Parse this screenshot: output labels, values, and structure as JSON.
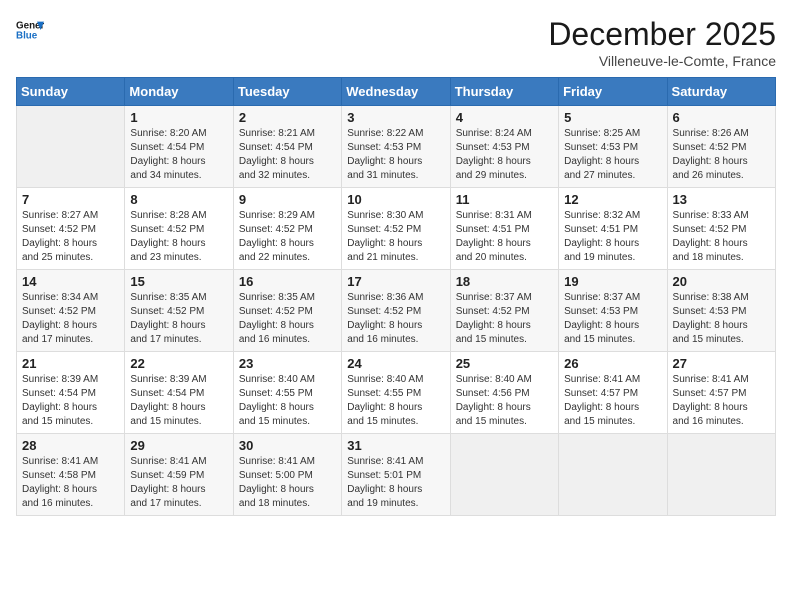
{
  "logo": {
    "line1": "General",
    "line2": "Blue"
  },
  "title": "December 2025",
  "location": "Villeneuve-le-Comte, France",
  "days_header": [
    "Sunday",
    "Monday",
    "Tuesday",
    "Wednesday",
    "Thursday",
    "Friday",
    "Saturday"
  ],
  "weeks": [
    [
      {
        "num": "",
        "info": ""
      },
      {
        "num": "1",
        "info": "Sunrise: 8:20 AM\nSunset: 4:54 PM\nDaylight: 8 hours\nand 34 minutes."
      },
      {
        "num": "2",
        "info": "Sunrise: 8:21 AM\nSunset: 4:54 PM\nDaylight: 8 hours\nand 32 minutes."
      },
      {
        "num": "3",
        "info": "Sunrise: 8:22 AM\nSunset: 4:53 PM\nDaylight: 8 hours\nand 31 minutes."
      },
      {
        "num": "4",
        "info": "Sunrise: 8:24 AM\nSunset: 4:53 PM\nDaylight: 8 hours\nand 29 minutes."
      },
      {
        "num": "5",
        "info": "Sunrise: 8:25 AM\nSunset: 4:53 PM\nDaylight: 8 hours\nand 27 minutes."
      },
      {
        "num": "6",
        "info": "Sunrise: 8:26 AM\nSunset: 4:52 PM\nDaylight: 8 hours\nand 26 minutes."
      }
    ],
    [
      {
        "num": "7",
        "info": "Sunrise: 8:27 AM\nSunset: 4:52 PM\nDaylight: 8 hours\nand 25 minutes."
      },
      {
        "num": "8",
        "info": "Sunrise: 8:28 AM\nSunset: 4:52 PM\nDaylight: 8 hours\nand 23 minutes."
      },
      {
        "num": "9",
        "info": "Sunrise: 8:29 AM\nSunset: 4:52 PM\nDaylight: 8 hours\nand 22 minutes."
      },
      {
        "num": "10",
        "info": "Sunrise: 8:30 AM\nSunset: 4:52 PM\nDaylight: 8 hours\nand 21 minutes."
      },
      {
        "num": "11",
        "info": "Sunrise: 8:31 AM\nSunset: 4:51 PM\nDaylight: 8 hours\nand 20 minutes."
      },
      {
        "num": "12",
        "info": "Sunrise: 8:32 AM\nSunset: 4:51 PM\nDaylight: 8 hours\nand 19 minutes."
      },
      {
        "num": "13",
        "info": "Sunrise: 8:33 AM\nSunset: 4:52 PM\nDaylight: 8 hours\nand 18 minutes."
      }
    ],
    [
      {
        "num": "14",
        "info": "Sunrise: 8:34 AM\nSunset: 4:52 PM\nDaylight: 8 hours\nand 17 minutes."
      },
      {
        "num": "15",
        "info": "Sunrise: 8:35 AM\nSunset: 4:52 PM\nDaylight: 8 hours\nand 17 minutes."
      },
      {
        "num": "16",
        "info": "Sunrise: 8:35 AM\nSunset: 4:52 PM\nDaylight: 8 hours\nand 16 minutes."
      },
      {
        "num": "17",
        "info": "Sunrise: 8:36 AM\nSunset: 4:52 PM\nDaylight: 8 hours\nand 16 minutes."
      },
      {
        "num": "18",
        "info": "Sunrise: 8:37 AM\nSunset: 4:52 PM\nDaylight: 8 hours\nand 15 minutes."
      },
      {
        "num": "19",
        "info": "Sunrise: 8:37 AM\nSunset: 4:53 PM\nDaylight: 8 hours\nand 15 minutes."
      },
      {
        "num": "20",
        "info": "Sunrise: 8:38 AM\nSunset: 4:53 PM\nDaylight: 8 hours\nand 15 minutes."
      }
    ],
    [
      {
        "num": "21",
        "info": "Sunrise: 8:39 AM\nSunset: 4:54 PM\nDaylight: 8 hours\nand 15 minutes."
      },
      {
        "num": "22",
        "info": "Sunrise: 8:39 AM\nSunset: 4:54 PM\nDaylight: 8 hours\nand 15 minutes."
      },
      {
        "num": "23",
        "info": "Sunrise: 8:40 AM\nSunset: 4:55 PM\nDaylight: 8 hours\nand 15 minutes."
      },
      {
        "num": "24",
        "info": "Sunrise: 8:40 AM\nSunset: 4:55 PM\nDaylight: 8 hours\nand 15 minutes."
      },
      {
        "num": "25",
        "info": "Sunrise: 8:40 AM\nSunset: 4:56 PM\nDaylight: 8 hours\nand 15 minutes."
      },
      {
        "num": "26",
        "info": "Sunrise: 8:41 AM\nSunset: 4:57 PM\nDaylight: 8 hours\nand 15 minutes."
      },
      {
        "num": "27",
        "info": "Sunrise: 8:41 AM\nSunset: 4:57 PM\nDaylight: 8 hours\nand 16 minutes."
      }
    ],
    [
      {
        "num": "28",
        "info": "Sunrise: 8:41 AM\nSunset: 4:58 PM\nDaylight: 8 hours\nand 16 minutes."
      },
      {
        "num": "29",
        "info": "Sunrise: 8:41 AM\nSunset: 4:59 PM\nDaylight: 8 hours\nand 17 minutes."
      },
      {
        "num": "30",
        "info": "Sunrise: 8:41 AM\nSunset: 5:00 PM\nDaylight: 8 hours\nand 18 minutes."
      },
      {
        "num": "31",
        "info": "Sunrise: 8:41 AM\nSunset: 5:01 PM\nDaylight: 8 hours\nand 19 minutes."
      },
      {
        "num": "",
        "info": ""
      },
      {
        "num": "",
        "info": ""
      },
      {
        "num": "",
        "info": ""
      }
    ]
  ]
}
